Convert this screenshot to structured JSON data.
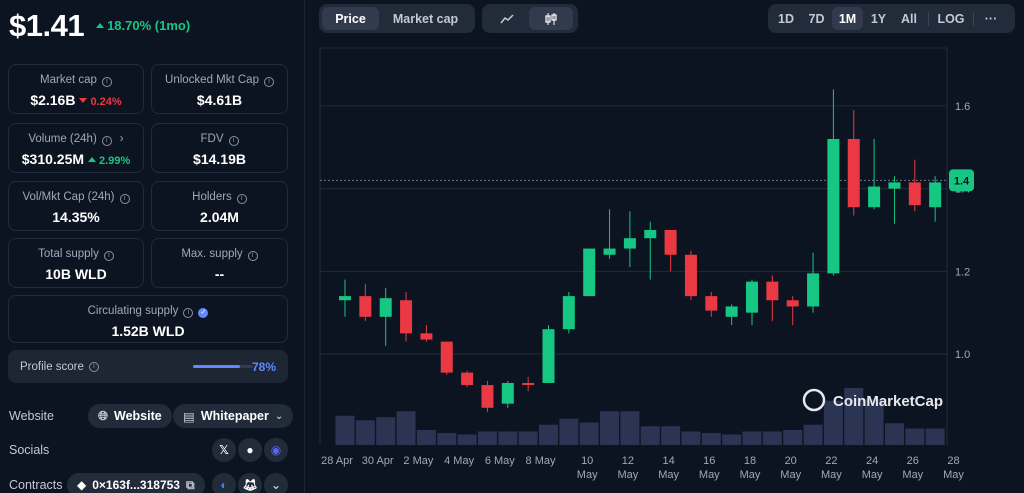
{
  "price": "$1.41",
  "change": "18.70% (1mo)",
  "stats": {
    "market_cap": {
      "label": "Market cap",
      "value": "$2.16B",
      "change": "0.24%"
    },
    "unlocked": {
      "label": "Unlocked Mkt Cap",
      "value": "$4.61B"
    },
    "volume": {
      "label": "Volume (24h)",
      "value": "$310.25M",
      "change": "2.99%"
    },
    "fdv": {
      "label": "FDV",
      "value": "$14.19B"
    },
    "vol_mkt": {
      "label": "Vol/Mkt Cap (24h)",
      "value": "14.35%"
    },
    "holders": {
      "label": "Holders",
      "value": "2.04M"
    },
    "total_supply": {
      "label": "Total supply",
      "value": "10B WLD"
    },
    "max_supply": {
      "label": "Max. supply",
      "value": "--"
    },
    "circ_supply": {
      "label": "Circulating supply",
      "value": "1.52B WLD"
    }
  },
  "profile": {
    "label": "Profile score",
    "value": "78%",
    "fraction": 0.78
  },
  "links": {
    "website_label": "Website",
    "website_btn": "Website",
    "whitepaper_btn": "Whitepaper",
    "socials_label": "Socials",
    "contracts_label": "Contracts",
    "contract": "0×163f...318753"
  },
  "toolbar": {
    "price_tab": "Price",
    "mcap_tab": "Market cap",
    "ranges": [
      "1D",
      "7D",
      "1M",
      "1Y",
      "All"
    ],
    "active_range": "1M",
    "log": "LOG",
    "more": "···"
  },
  "colors": {
    "up": "#16c784",
    "down": "#ea3943",
    "accent": "#6188ff",
    "volume": "#2b3452"
  },
  "watermark": "CoinMarketCap",
  "chart_data": {
    "type": "candlestick",
    "y_ticks": [
      "1.6",
      "1.4",
      "1.2",
      "1.0"
    ],
    "ylim": [
      0.78,
      1.74
    ],
    "current_price_label": "1.4",
    "current_price": 1.42,
    "x_labels": [
      [
        "28 Apr"
      ],
      [
        "30 Apr"
      ],
      [
        "2 May"
      ],
      [
        "4 May"
      ],
      [
        "6 May"
      ],
      [
        "8 May"
      ],
      [
        "10",
        "May"
      ],
      [
        "12",
        "May"
      ],
      [
        "14",
        "May"
      ],
      [
        "16",
        "May"
      ],
      [
        "18",
        "May"
      ],
      [
        "20",
        "May"
      ],
      [
        "22",
        "May"
      ],
      [
        "24",
        "May"
      ],
      [
        "26",
        "May"
      ],
      [
        "28",
        "May"
      ]
    ],
    "candles": [
      {
        "o": 1.13,
        "h": 1.18,
        "l": 1.09,
        "c": 1.14,
        "v": 0.39
      },
      {
        "o": 1.14,
        "h": 1.17,
        "l": 1.08,
        "c": 1.09,
        "v": 0.33
      },
      {
        "o": 1.09,
        "h": 1.16,
        "l": 1.02,
        "c": 1.135,
        "v": 0.37
      },
      {
        "o": 1.13,
        "h": 1.15,
        "l": 1.03,
        "c": 1.05,
        "v": 0.45
      },
      {
        "o": 1.05,
        "h": 1.07,
        "l": 1.03,
        "c": 1.035,
        "v": 0.2
      },
      {
        "o": 1.03,
        "h": 1.03,
        "l": 0.95,
        "c": 0.955,
        "v": 0.16
      },
      {
        "o": 0.955,
        "h": 0.96,
        "l": 0.92,
        "c": 0.925,
        "v": 0.14
      },
      {
        "o": 0.925,
        "h": 0.935,
        "l": 0.86,
        "c": 0.87,
        "v": 0.18
      },
      {
        "o": 0.88,
        "h": 0.935,
        "l": 0.87,
        "c": 0.93,
        "v": 0.18
      },
      {
        "o": 0.93,
        "h": 0.945,
        "l": 0.91,
        "c": 0.925,
        "v": 0.18
      },
      {
        "o": 0.93,
        "h": 1.07,
        "l": 0.93,
        "c": 1.06,
        "v": 0.27
      },
      {
        "o": 1.06,
        "h": 1.15,
        "l": 1.05,
        "c": 1.14,
        "v": 0.35
      },
      {
        "o": 1.14,
        "h": 1.24,
        "l": 1.14,
        "c": 1.255,
        "v": 0.3
      },
      {
        "o": 1.24,
        "h": 1.35,
        "l": 1.23,
        "c": 1.255,
        "v": 0.45
      },
      {
        "o": 1.255,
        "h": 1.345,
        "l": 1.21,
        "c": 1.28,
        "v": 0.45
      },
      {
        "o": 1.28,
        "h": 1.32,
        "l": 1.18,
        "c": 1.3,
        "v": 0.25
      },
      {
        "o": 1.3,
        "h": 1.3,
        "l": 1.2,
        "c": 1.24,
        "v": 0.25
      },
      {
        "o": 1.24,
        "h": 1.25,
        "l": 1.13,
        "c": 1.14,
        "v": 0.18
      },
      {
        "o": 1.14,
        "h": 1.15,
        "l": 1.09,
        "c": 1.105,
        "v": 0.16
      },
      {
        "o": 1.09,
        "h": 1.12,
        "l": 1.07,
        "c": 1.115,
        "v": 0.14
      },
      {
        "o": 1.1,
        "h": 1.18,
        "l": 1.07,
        "c": 1.175,
        "v": 0.18
      },
      {
        "o": 1.175,
        "h": 1.19,
        "l": 1.08,
        "c": 1.13,
        "v": 0.18
      },
      {
        "o": 1.13,
        "h": 1.14,
        "l": 1.07,
        "c": 1.115,
        "v": 0.2
      },
      {
        "o": 1.115,
        "h": 1.245,
        "l": 1.1,
        "c": 1.195,
        "v": 0.27
      },
      {
        "o": 1.195,
        "h": 1.64,
        "l": 1.19,
        "c": 1.52,
        "v": 0.59
      },
      {
        "o": 1.52,
        "h": 1.59,
        "l": 1.335,
        "c": 1.355,
        "v": 0.76
      },
      {
        "o": 1.355,
        "h": 1.52,
        "l": 1.35,
        "c": 1.405,
        "v": 0.61
      },
      {
        "o": 1.4,
        "h": 1.43,
        "l": 1.315,
        "c": 1.415,
        "v": 0.29
      },
      {
        "o": 1.415,
        "h": 1.47,
        "l": 1.345,
        "c": 1.36,
        "v": 0.22
      },
      {
        "o": 1.355,
        "h": 1.43,
        "l": 1.32,
        "c": 1.415,
        "v": 0.22
      }
    ]
  }
}
